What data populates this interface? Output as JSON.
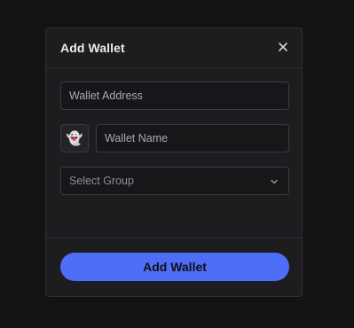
{
  "modal": {
    "title": "Add Wallet",
    "close_icon": "close-icon",
    "address_placeholder": "Wallet Address",
    "emoji": "👻",
    "name_placeholder": "Wallet Name",
    "group_placeholder": "Select Group",
    "group_icon": "chevron-down-icon",
    "submit_label": "Add Wallet"
  },
  "colors": {
    "accent": "#4f6ef7",
    "background": "#131315",
    "modal_bg": "#1d1d20"
  }
}
